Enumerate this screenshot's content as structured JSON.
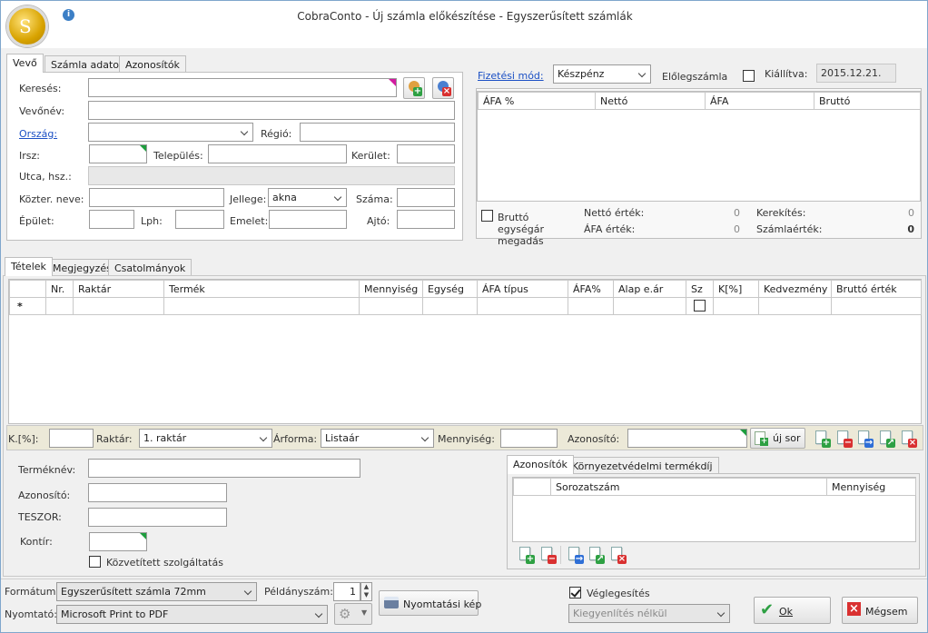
{
  "window": {
    "title": "CobraConto - Új számla előkészítése - Egyszerűsített számlák",
    "logo_icon": "cobra-logo",
    "info_icon": "info-icon"
  },
  "customer_tabs": [
    "Vevő",
    "Számla adatok",
    "Azonosítók"
  ],
  "customer": {
    "search_label": "Keresés:",
    "name_label": "Vevőnév:",
    "country_label": "Ország:",
    "region_label": "Régió:",
    "zip_label": "Irsz:",
    "city_label": "Település:",
    "district_label": "Kerület:",
    "street_label": "Utca, hsz.:",
    "public_place_label": "Közter. neve:",
    "type_label": "Jellege:",
    "type_value": "akna",
    "number_label": "Száma:",
    "building_label": "Épület:",
    "stair_label": "Lph:",
    "floor_label": "Emelet:",
    "door_label": "Ajtó:"
  },
  "payment": {
    "method_label": "Fizetési mód:",
    "method_value": "Készpénz",
    "advance_label": "Előlegszámla",
    "issued_label": "Kiállítva:",
    "issued_value": "2015.12.21."
  },
  "vat_table": {
    "columns": [
      "ÁFA %",
      "Nettó",
      "ÁFA",
      "Bruttó"
    ]
  },
  "totals": {
    "gross_unit_label": "Bruttó egységár megadás",
    "net_label": "Nettó érték:",
    "net_value": "0",
    "vat_label": "ÁFA érték:",
    "vat_value": "0",
    "rounding_label": "Kerekítés:",
    "rounding_value": "0",
    "invoice_label": "Számlaérték:",
    "invoice_value": "0"
  },
  "item_tabs": [
    "Tételek",
    "Megjegyzés",
    "Csatolmányok"
  ],
  "items_table": {
    "columns": [
      "Nr.",
      "Raktár",
      "Termék",
      "Mennyiség",
      "Egység",
      "ÁFA típus",
      "ÁFA%",
      "Alap e.ár",
      "Sz",
      "K[%]",
      "Kedvezmény",
      "Bruttó érték"
    ],
    "new_row_marker": "*"
  },
  "entry_bar": {
    "discount_label": "K.[%]:",
    "warehouse_label": "Raktár:",
    "warehouse_value": "1. raktár",
    "price_form_label": "Árforma:",
    "price_form_value": "Listaár",
    "quantity_label": "Mennyiség:",
    "id_label": "Azonosító:",
    "new_row_button": "új sor"
  },
  "product": {
    "name_label": "Terméknév:",
    "id_label": "Azonosító:",
    "teszor_label": "TESZOR:",
    "account_label": "Kontír:",
    "mediated_label": "Közvetített szolgáltatás"
  },
  "id_tabs": [
    "Azonosítók",
    "Környezetvédelmi termékdíj"
  ],
  "id_table": {
    "columns": [
      "Sorozatszám",
      "Mennyiség"
    ]
  },
  "footer": {
    "format_label": "Formátum:",
    "format_value": "Egyszerűsített számla 72mm",
    "copies_label": "Példányszám:",
    "copies_value": "1",
    "printer_label": "Nyomtató:",
    "printer_value": "Microsoft Print to PDF",
    "preview_button": "Nyomtatási kép",
    "finalize_label": "Véglegesítés",
    "settle_value": "Kiegyenlítés nélkül",
    "ok_button": "Ok",
    "cancel_button": "Mégsem"
  }
}
